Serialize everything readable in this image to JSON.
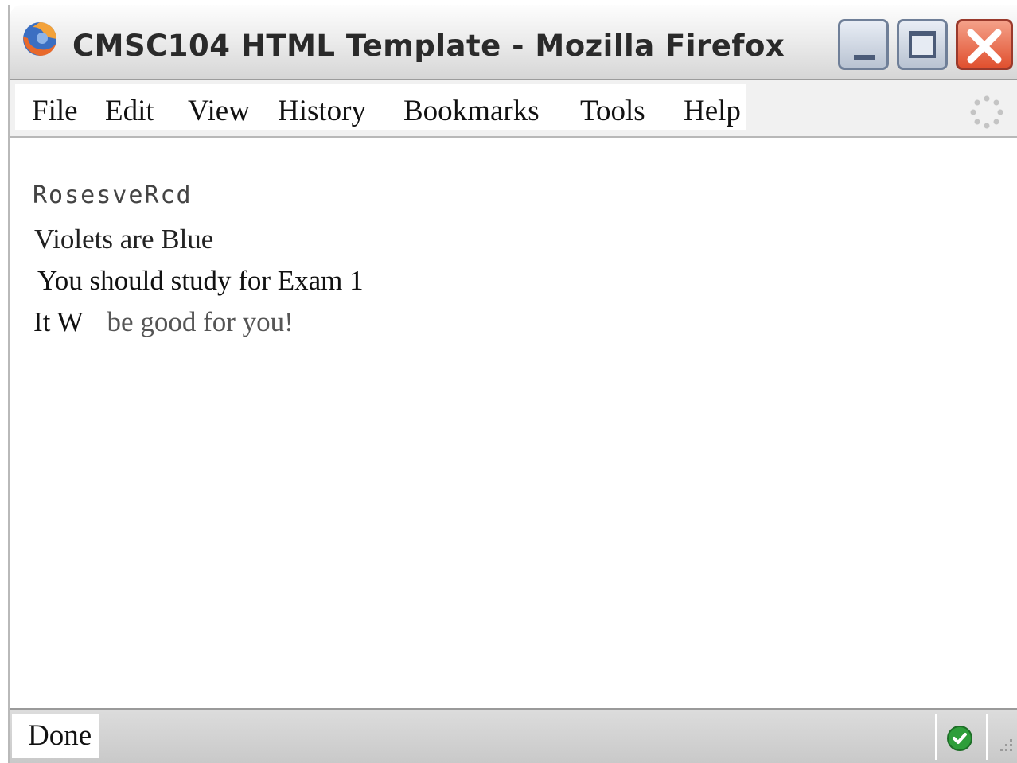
{
  "window": {
    "title": "CMSC104 HTML Template - Mozilla Firefox"
  },
  "menubar": {
    "items": [
      "File",
      "Edit",
      "View",
      "History",
      "Bookmarks",
      "Tools",
      "Help"
    ]
  },
  "content": {
    "line1": "RosesveRcd",
    "line2": "Violets are Blue",
    "line3": "You should study for Exam 1",
    "line4_start": "It W",
    "line4_end": "be good for you",
    "line4_punct": "!"
  },
  "statusbar": {
    "text": "Done"
  },
  "icons": {
    "app": "firefox-icon",
    "minimize": "minimize-icon",
    "maximize": "maximize-icon",
    "close": "close-icon",
    "throbber": "throbber-icon",
    "security": "secure-check-icon",
    "resize": "resize-grip-icon"
  },
  "colors": {
    "close_button": "#e0502f",
    "secure_badge": "#2e9e3a"
  }
}
